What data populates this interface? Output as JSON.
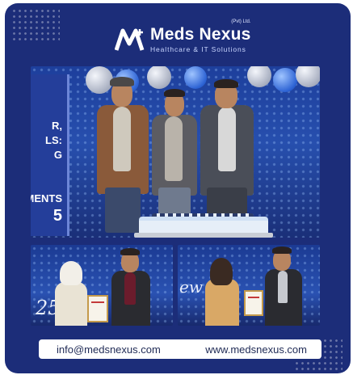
{
  "brand": {
    "name": "Meds Nexus",
    "suffix": "(Pvt) Ltd.",
    "tagline": "Healthcare & IT Solutions",
    "colors": {
      "background": "#1c2d79",
      "text": "#ffffff"
    }
  },
  "photos": {
    "main_banner_text": [
      "R,",
      "LS:",
      "G",
      "MENTS",
      "5"
    ],
    "left_backdrop_text": "25",
    "right_backdrop_text": "ew 25"
  },
  "contact": {
    "email": "info@medsnexus.com",
    "website": "www.medsnexus.com"
  }
}
